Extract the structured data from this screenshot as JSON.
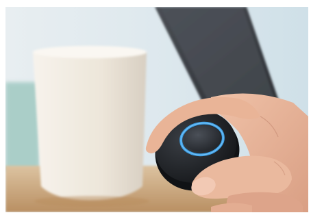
{
  "image": {
    "subject": "hand-holding-smart-button",
    "colors": {
      "background_light": "#d9e6ec",
      "background_teal": "#8fc0b8",
      "table_wood": "#c8a47c",
      "mug": "#f1ece3",
      "phone": "#3b3f44",
      "button_body": "#1f2226",
      "button_ring": "#3f9fe0",
      "skin": "#e8b49a"
    }
  }
}
